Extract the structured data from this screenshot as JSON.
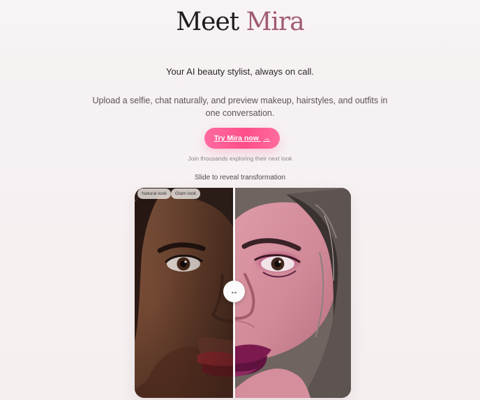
{
  "hero": {
    "title_main": "Meet",
    "title_accent": "Mira",
    "tagline": "Your AI beauty stylist, always on call.",
    "description": "Upload a selfie, chat naturally, and preview makeup, hairstyles, and outfits in one conversation.",
    "cta_label": "Try Mira now",
    "cta_icon": "→",
    "social_proof": "Join thousands exploring their next look"
  },
  "comparison": {
    "caption": "Slide to reveal transformation",
    "before_label": "Natural look",
    "after_label": "Glam look",
    "handle_icon": "↔"
  },
  "colors": {
    "background": "#f6f1f2",
    "accent": "#a05a74",
    "cta_gradient_start": "#ff6aa1",
    "cta_gradient_end": "#fd4f89"
  }
}
